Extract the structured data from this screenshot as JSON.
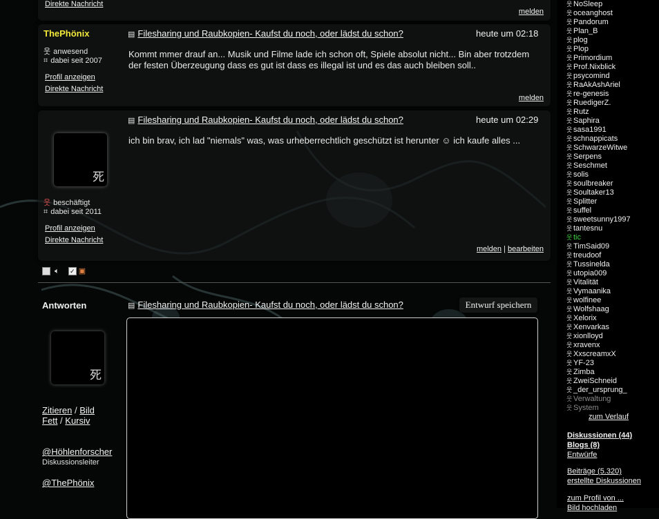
{
  "thread": {
    "title": "Filesharing und Raubkopien- Kaufst du noch, oder lädst du schon?"
  },
  "labels": {
    "report": "melden",
    "edit": "bearbeiten",
    "separator": "|",
    "profile": "Profil anzeigen",
    "direct_message": "Direkte Nachricht"
  },
  "posts": [
    {
      "author": "ThePhönix",
      "status": "anwesend",
      "member_since": "dabei seit 2007",
      "time": "heute um 02:18",
      "body": "Kommt mmer drauf an... Musik und Filme lade ich schon oft, Spiele absolut nicht... Bin aber trotzdem der festen Überzeugung dass es gut ist dass es illegal ist und es das auch bleiben soll.."
    },
    {
      "author": "",
      "avatar_glyph": "死",
      "status": "beschäftigt",
      "member_since": "dabei seit 2011",
      "time": "heute um 02:29",
      "body_before": "ich bin brav, ich lad \"niemals\" was, was urheberrechtlich geschützt ist herunter",
      "emoji": "☺",
      "body_after": "ich kaufe alles ..."
    }
  ],
  "reply": {
    "heading": "Antworten",
    "avatar_glyph": "死",
    "draft_button": "Entwurf speichern",
    "tools": {
      "quote": "Zitieren",
      "slash": "/",
      "image": "Bild",
      "bold": "Fett",
      "italic": "Kursiv"
    },
    "mentions": [
      {
        "name": "@Höhlenforscher",
        "role": "Diskussionsleiter"
      },
      {
        "name": "@ThePhönix",
        "role": ""
      }
    ]
  },
  "online_users": [
    {
      "name": "NoSleep"
    },
    {
      "name": "oceanghost"
    },
    {
      "name": "Pandorum"
    },
    {
      "name": "Plan_B"
    },
    {
      "name": "plog"
    },
    {
      "name": "Plop"
    },
    {
      "name": "Primordium"
    },
    {
      "name": "Prof.Nixblick"
    },
    {
      "name": "psycomind"
    },
    {
      "name": "RaAkAshAriel"
    },
    {
      "name": "re-genesis"
    },
    {
      "name": "RuedigerZ."
    },
    {
      "name": "Rutz"
    },
    {
      "name": "Saphira"
    },
    {
      "name": "sasa1991"
    },
    {
      "name": "schnappicats"
    },
    {
      "name": "SchwarzeWitwe"
    },
    {
      "name": "Serpens"
    },
    {
      "name": "Seschmet"
    },
    {
      "name": "solis"
    },
    {
      "name": "soulbreaker"
    },
    {
      "name": "Soultaker13"
    },
    {
      "name": "Splitter"
    },
    {
      "name": "suffel"
    },
    {
      "name": "sweetsunny1997"
    },
    {
      "name": "tantesnu"
    },
    {
      "name": "tic",
      "color": "#3fd43f"
    },
    {
      "name": "TimSaid09"
    },
    {
      "name": "treudoof"
    },
    {
      "name": "Tussinelda"
    },
    {
      "name": "utopia009"
    },
    {
      "name": "Vitalität"
    },
    {
      "name": "Vymaanika"
    },
    {
      "name": "wolfinee"
    },
    {
      "name": "Wolfshaag"
    },
    {
      "name": "Xelorix"
    },
    {
      "name": "Xenvarkas"
    },
    {
      "name": "xionlloyd"
    },
    {
      "name": "xravenx"
    },
    {
      "name": "XxscreamxX"
    },
    {
      "name": "YF-23"
    },
    {
      "name": "Zimba"
    },
    {
      "name": "ZweiSchneid"
    },
    {
      "name": "_der_ursprung_"
    },
    {
      "name": "Verwaltung",
      "color": "#8a8a8a"
    },
    {
      "name": "System",
      "color": "#8a8a8a"
    }
  ],
  "sidebar": {
    "history_link": "zum Verlauf",
    "discussions": "Diskussionen (44)",
    "blogs": "Blogs (8)",
    "drafts": "Entwürfe",
    "posts": "Beiträge (5.320)",
    "created_discussions": "erstellte Diskussionen",
    "profile_link": "zum Profil von ...",
    "cut_text": "Bild hochladen"
  },
  "icons": {
    "present": "person-present-icon",
    "busy": "person-busy-icon",
    "since": "calendar-icon",
    "doc": "document-icon"
  }
}
